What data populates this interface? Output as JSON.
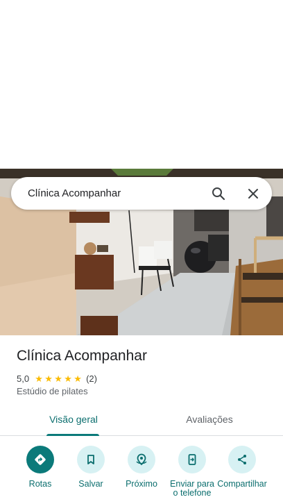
{
  "search": {
    "query": "Clínica Acompanhar",
    "search_icon": "search-icon",
    "close_icon": "close-icon"
  },
  "place": {
    "name": "Clínica Acompanhar",
    "rating": "5,0",
    "rating_value": 5,
    "review_count": "(2)",
    "category": "Estúdio de pilates",
    "star_color": "#fbbc04"
  },
  "tabs": [
    {
      "label": "Visão geral",
      "selected": true
    },
    {
      "label": "Avaliações",
      "selected": false
    }
  ],
  "actions": [
    {
      "label": "Rotas",
      "icon": "directions-icon"
    },
    {
      "label": "Salvar",
      "icon": "bookmark-icon"
    },
    {
      "label": "Próximo",
      "icon": "nearby-icon"
    },
    {
      "label": "Enviar para o telefone",
      "icon": "send-to-phone-icon"
    },
    {
      "label": "Compartilhar",
      "icon": "share-icon"
    }
  ],
  "colors": {
    "accent": "#0b7a7a",
    "action_bg": "#d7f1f3"
  }
}
